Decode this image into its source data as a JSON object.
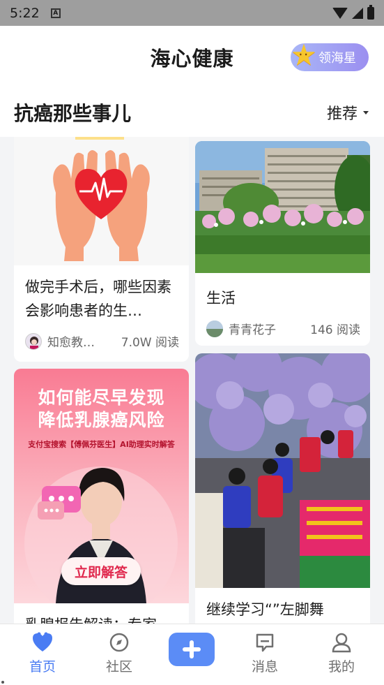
{
  "status_bar": {
    "time": "5:22",
    "notif_letter": "A"
  },
  "header": {
    "title": "海心健康",
    "star_button_label": "领海星"
  },
  "section": {
    "title": "抗癌那些事儿",
    "sort_label": "推荐"
  },
  "feed": {
    "cards": [
      {
        "title": "做完手术后，哪些因素会影响患者的生…",
        "author": "知愈教…",
        "reads": "7.0W 阅读",
        "image": "heart-hands-illustration"
      },
      {
        "title": "生活",
        "author": "青青花子",
        "reads": "146 阅读",
        "image": "apartment-flowers-photo"
      },
      {
        "title": "乳腺报告解读：专家",
        "author": "",
        "reads": "",
        "image": "breast-cancer-promo",
        "promo": {
          "headline_line1": "如何能尽早发现",
          "headline_line2": "降低乳腺癌风险",
          "sub": "支付宝搜索【傅佩芬医生】AI助理实时解答",
          "cta": "立即解答"
        }
      },
      {
        "title": "继续学习“”左脚舞",
        "author": "",
        "reads": "",
        "image": "folk-dance-photo"
      }
    ]
  },
  "tabbar": {
    "tabs": [
      {
        "label": "首页",
        "icon": "heart-icon",
        "active": true
      },
      {
        "label": "社区",
        "icon": "compass-icon",
        "active": false
      },
      {
        "label": "",
        "icon": "plus-icon",
        "active": false
      },
      {
        "label": "消息",
        "icon": "message-icon",
        "active": false
      },
      {
        "label": "我的",
        "icon": "user-icon",
        "active": false
      }
    ]
  },
  "colors": {
    "accent": "#4a7cf3",
    "plus_button": "#5b8cf6",
    "star_button_from": "#a9b6f7",
    "star_button_to": "#9b8ff0"
  }
}
